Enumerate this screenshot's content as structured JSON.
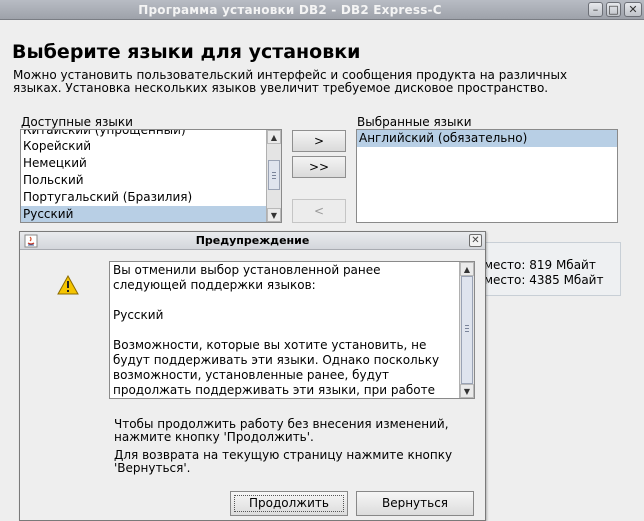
{
  "window": {
    "title": "Программа установки DB2 - DB2 Express-C"
  },
  "page": {
    "heading": "Выберите языки для установки",
    "description_line1": "Можно установить пользовательский интерфейс и сообщения продукта на различных",
    "description_line2": "языках. Установка нескольких языков увеличит требуемое дисковое пространство."
  },
  "available": {
    "label": "Доступные языки",
    "items": [
      "Китайский (упрощенный)",
      "Корейский",
      "Немецкий",
      "Польский",
      "Португальский (Бразилия)",
      "Русский"
    ],
    "selected_item": "Русский"
  },
  "selected": {
    "label": "Выбранные языки",
    "items": [
      "Английский (обязательно)"
    ]
  },
  "buttons": {
    "add": ">",
    "add_all": ">>",
    "remove": "<"
  },
  "disk_space": {
    "line1": "место: 819 Мбайт",
    "line2": "место: 4385 Мбайт"
  },
  "dialog": {
    "title": "Предупреждение",
    "message_lines": [
      "Вы отменили выбор установленной ранее",
      "следующей поддержки языков:",
      "",
      "Русский",
      "",
      " Возможности, которые вы хотите установить, не",
      "будут поддерживать эти языки. Однако поскольку",
      "возможности, установленные ранее, будут",
      "продолжать поддерживать эти языки, при работе"
    ],
    "continue_hint_line1": "Чтобы продолжить работу без внесения изменений,",
    "continue_hint_line2": "нажмите кнопку 'Продолжить'.",
    "back_hint_line1": "Для возврата на текущую страницу нажмите кнопку",
    "back_hint_line2": "'Вернуться'.",
    "continue_button": "Продолжить",
    "back_button": "Вернуться"
  },
  "icons": {
    "warning": "warning-icon",
    "app": "java-app-icon",
    "close": "close-icon"
  },
  "colors": {
    "selection": "#b8cfe5",
    "warning_yellow": "#f5c400"
  }
}
